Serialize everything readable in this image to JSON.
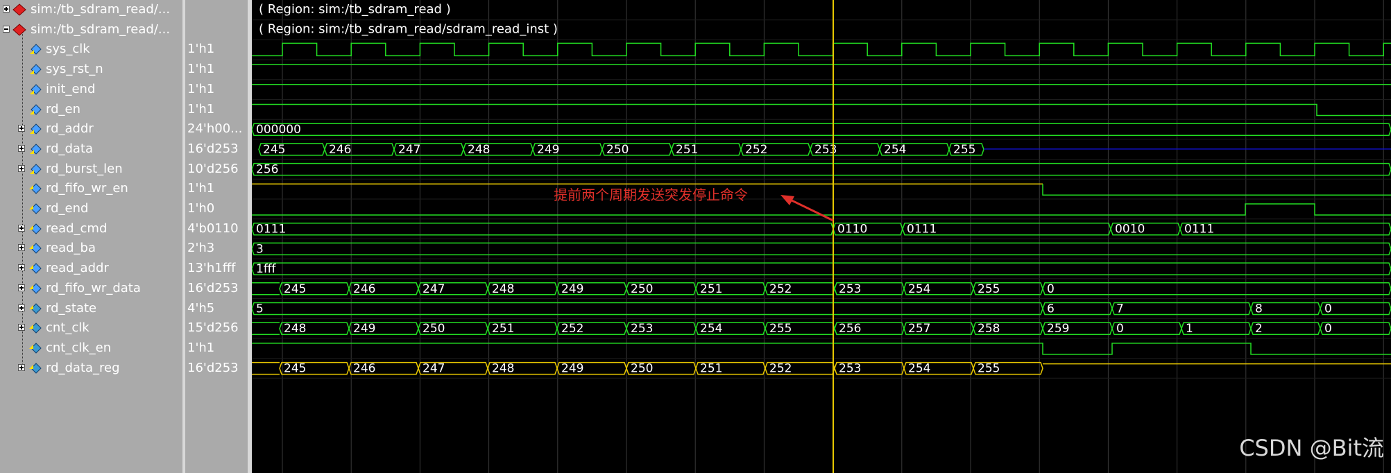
{
  "colors": {
    "green": "#22dd22",
    "yellow": "#e8c800",
    "cursor": "#e8c800",
    "blue": "#1010c0",
    "annotation": "#e0302a",
    "grid": "#3a3a3a",
    "pane": "#aaaaaa"
  },
  "signals": [
    {
      "name": "sim:/tb_sdram_read/...",
      "value": "",
      "expand": "plus",
      "icon": "red-diamond-icon",
      "indent": 0
    },
    {
      "name": "sim:/tb_sdram_read/...",
      "value": "",
      "expand": "minus",
      "icon": "red-diamond-icon",
      "indent": 0
    },
    {
      "name": "sys_clk",
      "value": "1'h1",
      "expand": "",
      "icon": "input-signal-icon",
      "indent": 1
    },
    {
      "name": "sys_rst_n",
      "value": "1'h1",
      "expand": "",
      "icon": "input-signal-icon",
      "indent": 1
    },
    {
      "name": "init_end",
      "value": "1'h1",
      "expand": "",
      "icon": "input-signal-icon",
      "indent": 1
    },
    {
      "name": "rd_en",
      "value": "1'h1",
      "expand": "",
      "icon": "input-signal-icon",
      "indent": 1
    },
    {
      "name": "rd_addr",
      "value": "24'h00...",
      "expand": "plus",
      "icon": "input-signal-icon",
      "indent": 1
    },
    {
      "name": "rd_data",
      "value": "16'd253",
      "expand": "plus",
      "icon": "input-signal-icon",
      "indent": 1
    },
    {
      "name": "rd_burst_len",
      "value": "10'd256",
      "expand": "plus",
      "icon": "input-signal-icon",
      "indent": 1
    },
    {
      "name": "rd_fifo_wr_en",
      "value": "1'h1",
      "expand": "",
      "icon": "output-signal-icon",
      "indent": 1
    },
    {
      "name": "rd_end",
      "value": "1'h0",
      "expand": "",
      "icon": "output-signal-icon",
      "indent": 1
    },
    {
      "name": "read_cmd",
      "value": "4'b0110",
      "expand": "plus",
      "icon": "output-signal-icon",
      "indent": 1
    },
    {
      "name": "read_ba",
      "value": "2'h3",
      "expand": "plus",
      "icon": "output-signal-icon",
      "indent": 1
    },
    {
      "name": "read_addr",
      "value": "13'h1fff",
      "expand": "plus",
      "icon": "output-signal-icon",
      "indent": 1
    },
    {
      "name": "rd_fifo_wr_data",
      "value": "16'd253",
      "expand": "plus",
      "icon": "output-signal-icon",
      "indent": 1
    },
    {
      "name": "rd_state",
      "value": "4'h5",
      "expand": "plus",
      "icon": "internal-signal-icon",
      "indent": 1
    },
    {
      "name": "cnt_clk",
      "value": "15'd256",
      "expand": "plus",
      "icon": "internal-signal-icon",
      "indent": 1
    },
    {
      "name": "cnt_clk_en",
      "value": "1'h1",
      "expand": "",
      "icon": "internal-signal-icon",
      "indent": 1
    },
    {
      "name": "rd_data_reg",
      "value": "16'd253",
      "expand": "plus",
      "icon": "internal-signal-icon",
      "indent": 1
    }
  ],
  "regions": [
    "( Region: sim:/tb_sdram_read )",
    "( Region: sim:/tb_sdram_read/sdram_read_inst )"
  ],
  "annotation": "提前两个周期发送突发停止命令",
  "watermark": "CSDN @Bit流",
  "waves": {
    "rd_addr": [
      [
        "000000",
        0,
        1642
      ]
    ],
    "rd_data": [
      [
        "245",
        10,
        105
      ],
      [
        "246",
        105,
        205
      ],
      [
        "247",
        205,
        305
      ],
      [
        "248",
        305,
        405
      ],
      [
        "249",
        405,
        505
      ],
      [
        "250",
        505,
        605
      ],
      [
        "251",
        605,
        705
      ],
      [
        "252",
        705,
        805
      ],
      [
        "253",
        805,
        905
      ],
      [
        "254",
        905,
        1005
      ],
      [
        "255",
        1005,
        1055
      ]
    ],
    "rd_burst_len": [
      [
        "256",
        0,
        1642
      ]
    ],
    "read_cmd": [
      [
        "0111",
        0,
        838
      ],
      [
        "0110",
        838,
        938
      ],
      [
        "0111",
        938,
        1238
      ],
      [
        "0010",
        1238,
        1338
      ],
      [
        "0111",
        1338,
        1642
      ]
    ],
    "read_ba": [
      [
        "3",
        0,
        1642
      ]
    ],
    "read_addr": [
      [
        "1fff",
        0,
        1642
      ]
    ],
    "rd_fifo_wr_data": [
      [
        "",
        0,
        40
      ],
      [
        "245",
        40,
        140
      ],
      [
        "246",
        140,
        240
      ],
      [
        "247",
        240,
        340
      ],
      [
        "248",
        340,
        440
      ],
      [
        "249",
        440,
        540
      ],
      [
        "250",
        540,
        640
      ],
      [
        "251",
        640,
        740
      ],
      [
        "252",
        740,
        840
      ],
      [
        "253",
        840,
        940
      ],
      [
        "254",
        940,
        1040
      ],
      [
        "255",
        1040,
        1140
      ],
      [
        "0",
        1140,
        1642
      ]
    ],
    "rd_state": [
      [
        "5",
        0,
        1140
      ],
      [
        "6",
        1140,
        1240
      ],
      [
        "7",
        1240,
        1440
      ],
      [
        "8",
        1440,
        1540
      ],
      [
        "0",
        1540,
        1642
      ]
    ],
    "cnt_clk": [
      [
        "",
        0,
        40
      ],
      [
        "248",
        40,
        140
      ],
      [
        "249",
        140,
        240
      ],
      [
        "250",
        240,
        340
      ],
      [
        "251",
        340,
        440
      ],
      [
        "252",
        440,
        540
      ],
      [
        "253",
        540,
        640
      ],
      [
        "254",
        640,
        740
      ],
      [
        "255",
        740,
        840
      ],
      [
        "256",
        840,
        940
      ],
      [
        "257",
        940,
        1040
      ],
      [
        "258",
        1040,
        1140
      ],
      [
        "259",
        1140,
        1240
      ],
      [
        "0",
        1240,
        1340
      ],
      [
        "1",
        1340,
        1440
      ],
      [
        "2",
        1440,
        1540
      ],
      [
        "0",
        1540,
        1642
      ]
    ],
    "rd_data_reg": [
      [
        "",
        0,
        40
      ],
      [
        "245",
        40,
        140
      ],
      [
        "246",
        140,
        240
      ],
      [
        "247",
        240,
        340
      ],
      [
        "248",
        340,
        440
      ],
      [
        "249",
        440,
        540
      ],
      [
        "250",
        540,
        640
      ],
      [
        "251",
        640,
        740
      ],
      [
        "252",
        740,
        840
      ],
      [
        "253",
        840,
        940
      ],
      [
        "254",
        940,
        1040
      ],
      [
        "255",
        1040,
        1140
      ]
    ]
  }
}
